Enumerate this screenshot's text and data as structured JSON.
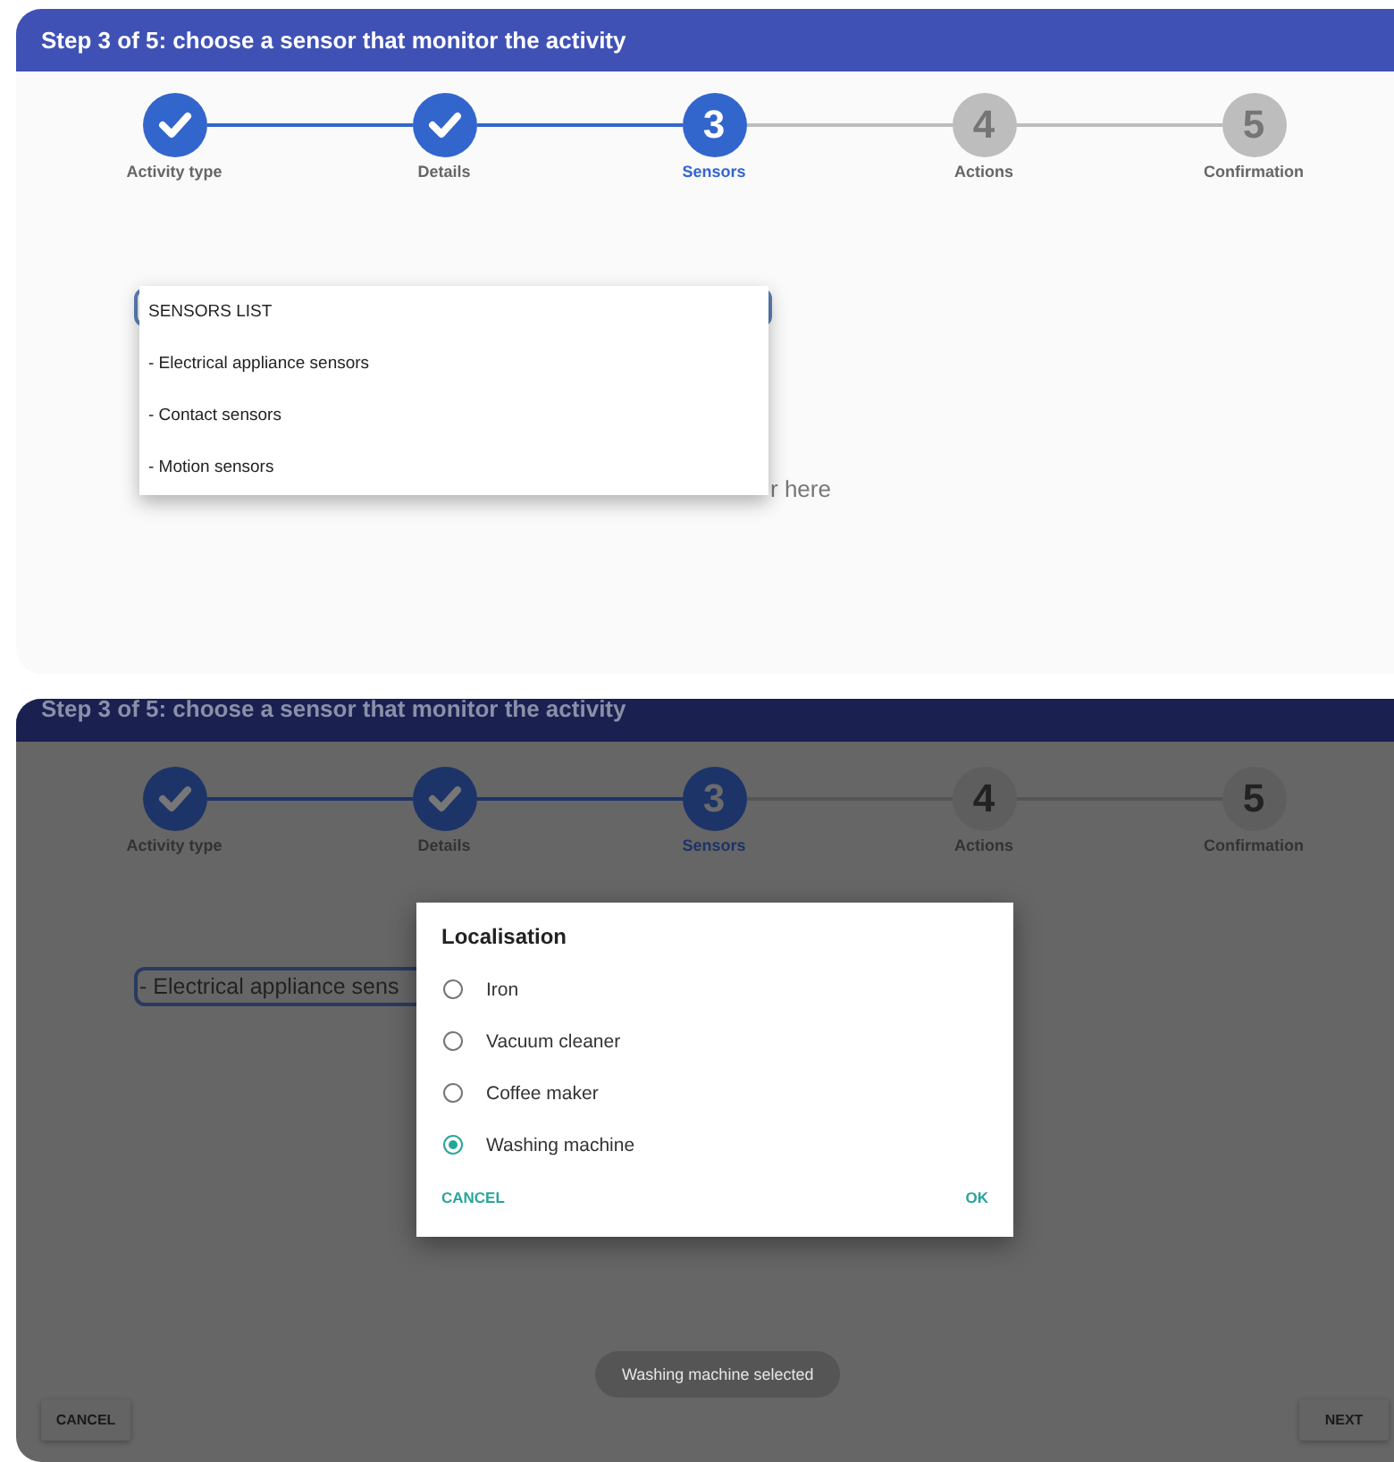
{
  "screens": [
    {
      "dimmed": false,
      "header": {
        "title": "Step 3 of 5: choose a sensor that monitor the activity"
      },
      "steps": [
        {
          "label": "Activity type",
          "done": true,
          "current": false
        },
        {
          "label": "Details",
          "done": true,
          "current": false
        },
        {
          "label": "Sensors",
          "done": false,
          "current": true,
          "number": "3"
        },
        {
          "label": "Actions",
          "done": false,
          "current": false,
          "number": "4"
        },
        {
          "label": "Confirmation",
          "done": false,
          "current": false,
          "number": "5"
        }
      ],
      "popup": {
        "title": "SENSORS LIST",
        "items": [
          "- Electrical appliance sensors",
          "- Contact sensors",
          "- Motion sensors"
        ]
      },
      "hint": "r here"
    },
    {
      "dimmed": true,
      "header": {
        "title": "Step 3 of 5: choose a sensor that monitor the activity"
      },
      "steps": [
        {
          "label": "Activity type",
          "done": true,
          "current": false
        },
        {
          "label": "Details",
          "done": true,
          "current": false
        },
        {
          "label": "Sensors",
          "done": false,
          "current": true,
          "number": "3"
        },
        {
          "label": "Actions",
          "done": false,
          "current": false,
          "number": "4"
        },
        {
          "label": "Confirmation",
          "done": false,
          "current": false,
          "number": "5"
        }
      ],
      "dropdown": {
        "value": "- Electrical appliance sens"
      },
      "dialog": {
        "title": "Localisation",
        "options": [
          {
            "label": "Iron",
            "selected": false
          },
          {
            "label": "Vacuum cleaner",
            "selected": false
          },
          {
            "label": "Coffee maker",
            "selected": false
          },
          {
            "label": "Washing machine",
            "selected": true
          }
        ],
        "buttons": [
          "CANCEL",
          "OK"
        ]
      },
      "toast": "Washing machine selected",
      "buttons": [
        "CANCEL",
        "NEXT"
      ]
    }
  ]
}
